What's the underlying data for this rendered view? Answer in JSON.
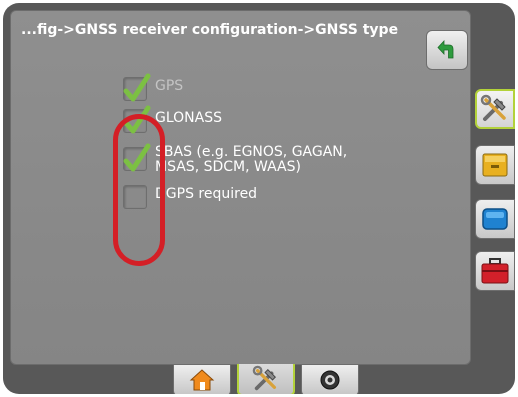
{
  "header": {
    "breadcrumb": "...fig->GNSS receiver configuration->GNSS type"
  },
  "options": [
    {
      "label": "GPS",
      "checked": true,
      "enabled": false
    },
    {
      "label": "GLONASS",
      "checked": true,
      "enabled": true
    },
    {
      "label": "SBAS (e.g. EGNOS, GAGAN,",
      "label_line2": "MSAS, SDCM, WAAS)",
      "checked": true,
      "enabled": true
    },
    {
      "label": "DGPS required",
      "checked": false,
      "enabled": true
    }
  ],
  "side_tabs": [
    {
      "icon": "tools-icon",
      "active": true
    },
    {
      "icon": "data-folder-icon",
      "active": false
    },
    {
      "icon": "display-icon",
      "active": false
    },
    {
      "icon": "toolbox-icon",
      "active": false
    }
  ],
  "bottom_tabs": [
    {
      "icon": "home-icon",
      "active": false
    },
    {
      "icon": "tools-icon",
      "active": true
    },
    {
      "icon": "camera-icon",
      "active": false
    }
  ],
  "colors": {
    "panel": "#8a8a8a",
    "bezel": "#585858",
    "check": "#7cc043",
    "active_border": "#b3d23a",
    "annotation": "#d41f26",
    "back_arrow": "#2e9b3e"
  }
}
